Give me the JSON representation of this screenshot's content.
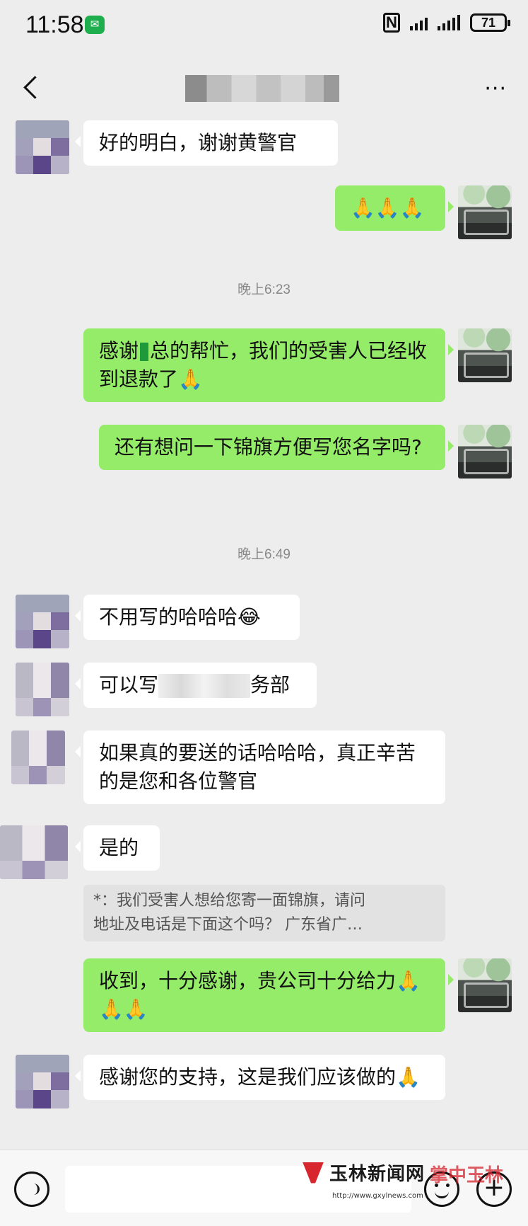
{
  "status_bar": {
    "time": "11:58",
    "battery": "71",
    "network": "4G"
  },
  "header": {
    "more": "···"
  },
  "messages": [
    {
      "side": "in",
      "text": "好的明白，谢谢黄警官"
    },
    {
      "side": "out",
      "text": "🙏🙏🙏"
    },
    {
      "time": "晚上6:23"
    },
    {
      "side": "out",
      "text_before": "感谢",
      "text_after": "总的帮忙，我们的受害人已经收到退款了🙏"
    },
    {
      "side": "out",
      "text": "还有想问一下锦旗方便写您名字吗?"
    },
    {
      "time": "晚上6:49"
    },
    {
      "side": "in",
      "text": "不用写的哈哈哈😂"
    },
    {
      "side": "in",
      "text_before": "可以写",
      "text_after": "务部"
    },
    {
      "side": "in",
      "text": "如果真的要送的话哈哈哈，真正辛苦的是您和各位警官"
    },
    {
      "side": "in",
      "text": "是的"
    },
    {
      "quote": "*：我们受害人想给您寄一面锦旗，请问\n地址及电话是下面这个吗？ 广东省广…"
    },
    {
      "side": "out",
      "text": " 收到，十分感谢，贵公司十分给力🙏🙏🙏"
    },
    {
      "side": "in",
      "text": "感谢您的支持，这是我们应该做的🙏"
    }
  ],
  "watermark": {
    "name": "玉林新闻网",
    "url": "http://www.gxylnews.com",
    "app": "掌中玉林"
  },
  "colors": {
    "background": "#ededed",
    "outgoing_bubble": "#95ec69",
    "incoming_bubble": "#ffffff",
    "watermark_red": "#d8262e"
  }
}
